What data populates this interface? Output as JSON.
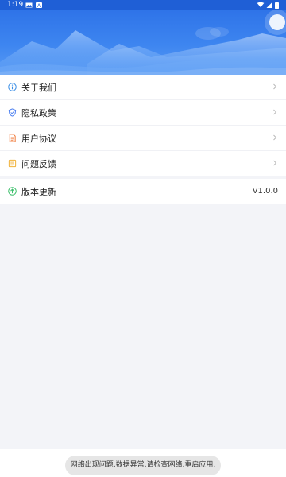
{
  "status_bar": {
    "time": "1:19",
    "icons": [
      "image-icon",
      "notification-a-icon",
      "wifi-icon",
      "signal-icon",
      "battery-icon"
    ]
  },
  "banner": {
    "color": "#2f74ea"
  },
  "menu": {
    "items": [
      {
        "label": "关于我们",
        "icon": "info-icon",
        "color": "#3a8ee6",
        "trailing": "chevron"
      },
      {
        "label": "隐私政策",
        "icon": "shield-icon",
        "color": "#4a7ef0",
        "trailing": "chevron"
      },
      {
        "label": "用户协议",
        "icon": "document-icon",
        "color": "#f07a3a",
        "trailing": "chevron"
      },
      {
        "label": "问题反馈",
        "icon": "feedback-icon",
        "color": "#f0b23a",
        "trailing": "chevron"
      }
    ],
    "update": {
      "label": "版本更新",
      "icon": "upload-icon",
      "color": "#3bbf6a",
      "version": "V1.0.0"
    }
  },
  "toast": {
    "message": "网络出现问题,数据异常,请检查网络,重启应用."
  }
}
